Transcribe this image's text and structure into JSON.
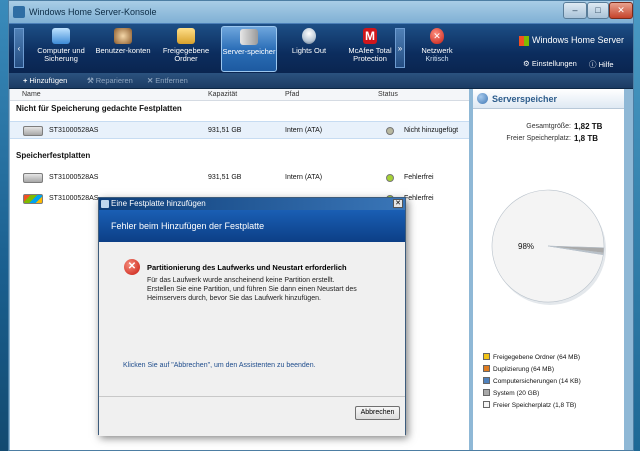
{
  "window": {
    "title": "Windows Home Server-Konsole",
    "min_label": "–",
    "max_label": "□",
    "close_label": "✕"
  },
  "nav": {
    "items": [
      {
        "label": "Computer und Sicherung",
        "icon": "computer-backup-icon"
      },
      {
        "label": "Benutzer-konten",
        "icon": "users-icon"
      },
      {
        "label": "Freigegebene Ordner",
        "icon": "shared-folders-icon"
      },
      {
        "label": "Server-speicher",
        "icon": "server-storage-icon",
        "active": true
      },
      {
        "label": "Lights Out",
        "icon": "lights-out-icon"
      },
      {
        "label": "McAfee Total Protection",
        "icon": "mcafee-icon"
      },
      {
        "label": "Netzwerk",
        "sub": "Kritisch",
        "icon": "network-critical-icon"
      }
    ],
    "scroll_left": "‹",
    "scroll_right": "»",
    "brand": "Windows Home Server",
    "settings_label": "Einstellungen",
    "help_label": "Hilfe"
  },
  "toolbar": {
    "add": "Hinzufügen",
    "repair": "Reparieren",
    "remove": "Entfernen"
  },
  "list": {
    "columns": [
      "Name",
      "Kapazität",
      "Pfad",
      "Status"
    ],
    "section1": "Nicht für Speicherung gedachte Festplatten",
    "section2": "Speicherfestplatten",
    "rows": [
      {
        "name": "ST31000528AS",
        "capacity": "931,51 GB",
        "path": "Intern (ATA)",
        "status": "Nicht hinzugefügt",
        "dot": "#b8b8a0"
      },
      {
        "name": "ST31000528AS",
        "capacity": "931,51 GB",
        "path": "Intern (ATA)",
        "status": "Fehlerfrei",
        "dot": "#9acd32"
      },
      {
        "name": "ST31000528AS",
        "capacity": "",
        "path": "",
        "status": "Fehlerfrei",
        "dot": "#9acd32"
      }
    ]
  },
  "storage": {
    "title": "Serverspeicher",
    "total_label": "Gesamtgröße:",
    "total_value": "1,82 TB",
    "free_label": "Freier Speicherplatz:",
    "free_value": "1,8 TB",
    "pie_label": "98%",
    "legend": [
      {
        "label": "Freigegebene Ordner (64 MB)",
        "color": "#f2c418"
      },
      {
        "label": "Duplizierung (64 MB)",
        "color": "#e07c20"
      },
      {
        "label": "Computersicherungen (14 KB)",
        "color": "#4f81bd"
      },
      {
        "label": "System (20 GB)",
        "color": "#a9a9a9"
      },
      {
        "label": "Freier Speicherplatz (1,8 TB)",
        "color": "#f4f4f4"
      }
    ]
  },
  "chart_data": {
    "type": "pie",
    "title": "",
    "slices": [
      {
        "label": "Freier Speicherplatz (1,8 TB)",
        "value": 98
      },
      {
        "label": "System (20 GB)",
        "value": 1.5
      },
      {
        "label": "Freigegebene Ordner (64 MB)",
        "value": 0.2
      },
      {
        "label": "Duplizierung (64 MB)",
        "value": 0.2
      },
      {
        "label": "Computersicherungen (14 KB)",
        "value": 0.1
      }
    ],
    "data_label": "98%"
  },
  "dialog": {
    "title": "Eine Festplatte hinzufügen",
    "close_label": "✕",
    "banner": "Fehler beim Hinzufügen der Festplatte",
    "error_heading": "Partitionierung des Laufwerks und Neustart erforderlich",
    "error_lines": [
      "Für das Laufwerk wurde anscheinend keine Partition erstellt.",
      "Erstellen Sie eine Partition, und führen Sie dann einen Neustart des",
      "Heimservers durch, bevor Sie das Laufwerk hinzufügen."
    ],
    "hint": "Klicken Sie auf \"Abbrechen\", um den Assistenten zu beenden.",
    "cancel_label": "Abbrechen"
  }
}
